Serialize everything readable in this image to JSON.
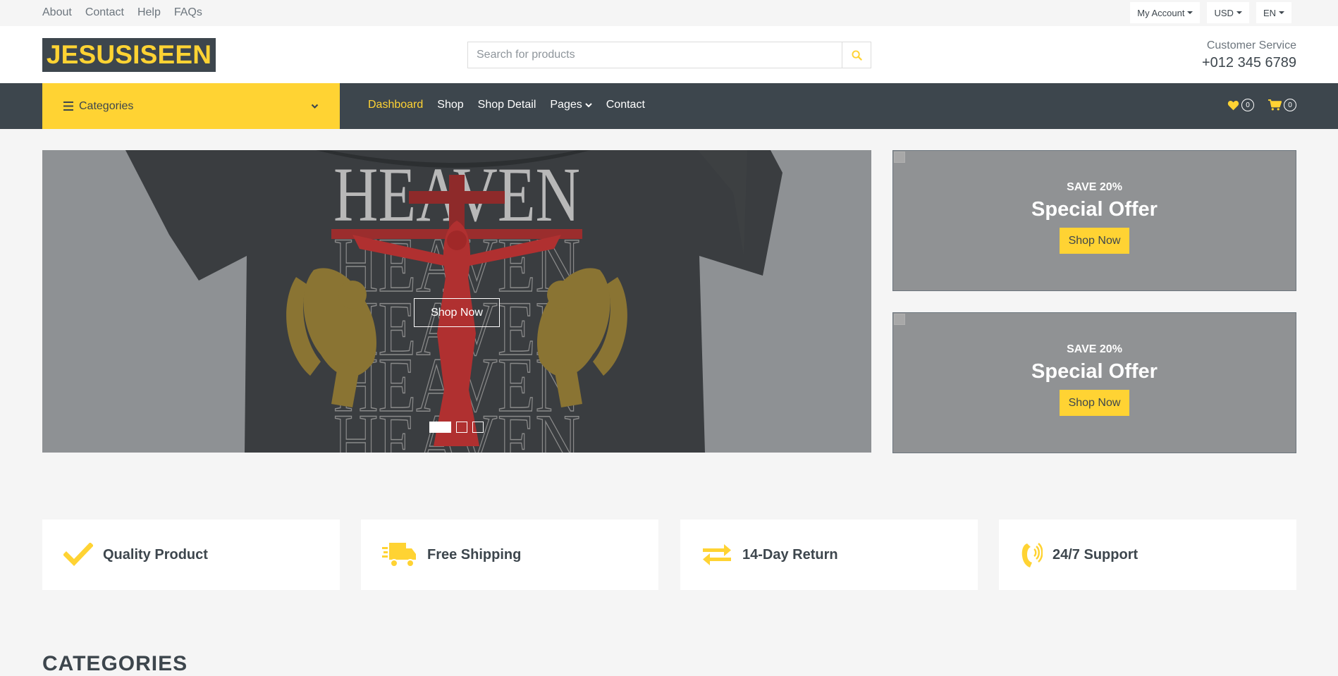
{
  "topbar": {
    "links": [
      "About",
      "Contact",
      "Help",
      "FAQs"
    ],
    "dropdowns": [
      "My Account",
      "USD",
      "EN"
    ]
  },
  "header": {
    "logo": "JESUSISEEN",
    "search_placeholder": "Search for products",
    "customer_service_label": "Customer Service",
    "phone": "+012 345 6789"
  },
  "navbar": {
    "categories_label": "Categories",
    "links": [
      "Dashboard",
      "Shop",
      "Shop Detail",
      "Pages",
      "Contact"
    ],
    "active": "Dashboard",
    "wishlist_count": "0",
    "cart_count": "0"
  },
  "hero": {
    "button_label": "Shop Now",
    "print_text": "HEAVEN",
    "slides": 3,
    "active_slide": 1
  },
  "offers": [
    {
      "save": "SAVE 20%",
      "title": "Special Offer",
      "button": "Shop Now"
    },
    {
      "save": "SAVE 20%",
      "title": "Special Offer",
      "button": "Shop Now"
    }
  ],
  "features": [
    {
      "icon": "check-icon",
      "label": "Quality Product"
    },
    {
      "icon": "shipping-truck-icon",
      "label": "Free Shipping"
    },
    {
      "icon": "exchange-arrows-icon",
      "label": "14-Day Return"
    },
    {
      "icon": "phone-volume-icon",
      "label": "24/7 Support"
    }
  ],
  "section_title": "CATEGORIES",
  "colors": {
    "accent": "#ffd333",
    "dark": "#3d464d",
    "background": "#f5f5f5",
    "muted": "#6c757d"
  }
}
